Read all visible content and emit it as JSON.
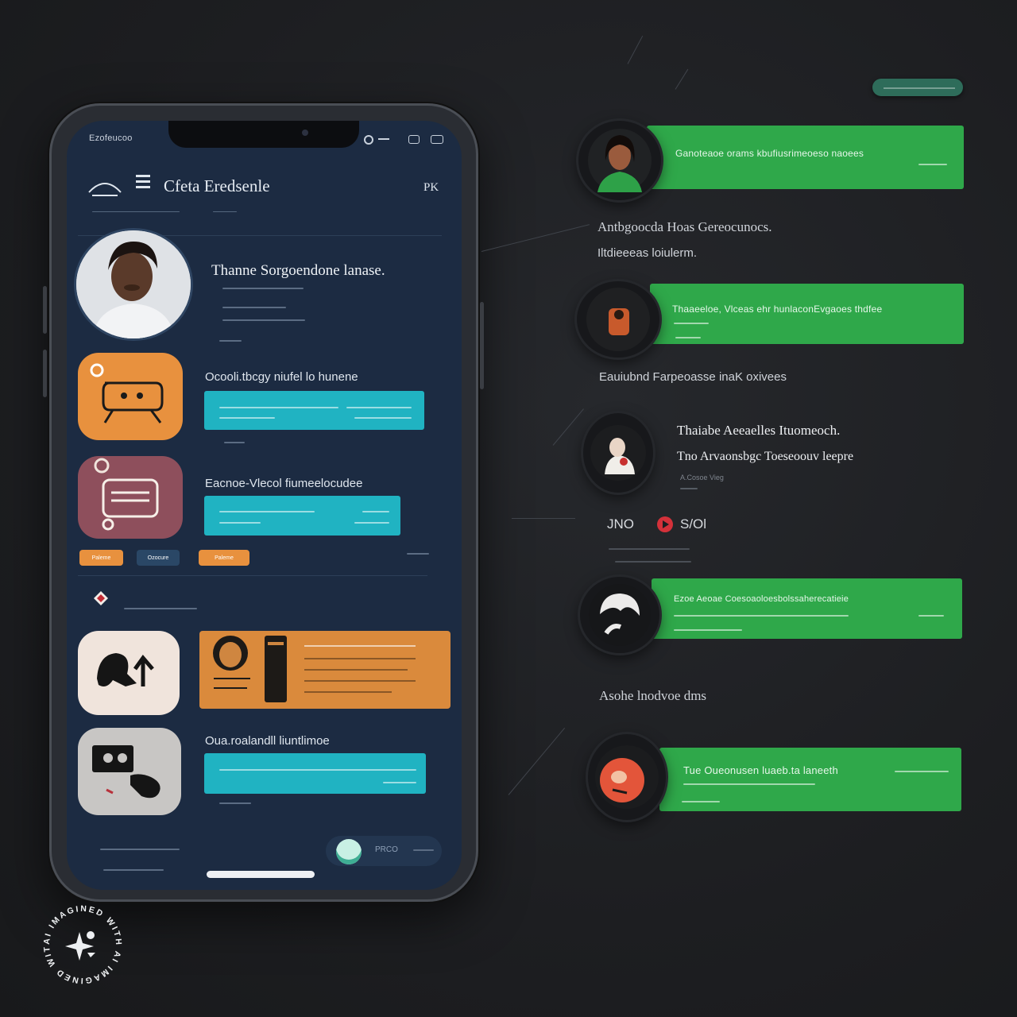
{
  "phone": {
    "status_left": "Ezofeucoo",
    "header": {
      "title": "Cfeta Eredsenle",
      "action": "PK"
    },
    "profile": {
      "headline": "Thanne Sorgoendone lanase."
    },
    "chats": [
      {
        "label": "Ocooli.tbcgy niufel lo hunene"
      },
      {
        "label": "Eacnoe-Vlecol fiumeelocudee"
      }
    ],
    "chips": [
      "Paleme",
      "Ozocure",
      "Paleme"
    ],
    "card": {
      "label": "Oua.roalandll liuntlimoe"
    },
    "bottom": {
      "pill_text": "PRCO"
    }
  },
  "side": {
    "pill_top": "",
    "items": [
      {
        "bar_text": "Ganoteaoe orams kbufiusrimeoeso naoees"
      },
      {
        "caption": "Antbgoocda Hoas Gereocunocs.",
        "sub": "Iltdieeeas  loiulerm."
      },
      {
        "bar_text": "Thaaeeloe, Vlceas ehr hunlaconEvgaoes thdfee"
      },
      {
        "caption": "Eauiubnd Farpeoasse inaK oxivees"
      },
      {
        "headline1": "Thaiabe Aeeaelles Ituomeoch.",
        "headline2": "Tno Arvaonsbgc Toeseoouv leepre",
        "small": "A.Cosoe Vieg"
      },
      {
        "label_left": "JNO",
        "label_right": "S/Ol"
      },
      {
        "bar_text": "Ezoe Aeoae Coesoaoloesbolssaherecatieie"
      },
      {
        "caption": "Asohe lnodvoe dms"
      },
      {
        "bar_text": "Tue Oueonusen luaeb.ta laneeth"
      }
    ]
  },
  "watermark": {
    "text": "AI IMAGINED WITH AI IMAGINED WITH"
  },
  "colors": {
    "screen_bg": "#1c2b42",
    "teal": "#20b3c2",
    "orange": "#e8913e",
    "mauve": "#8e4f5c",
    "green": "#2fa84a",
    "cream": "#f0e4dc"
  }
}
